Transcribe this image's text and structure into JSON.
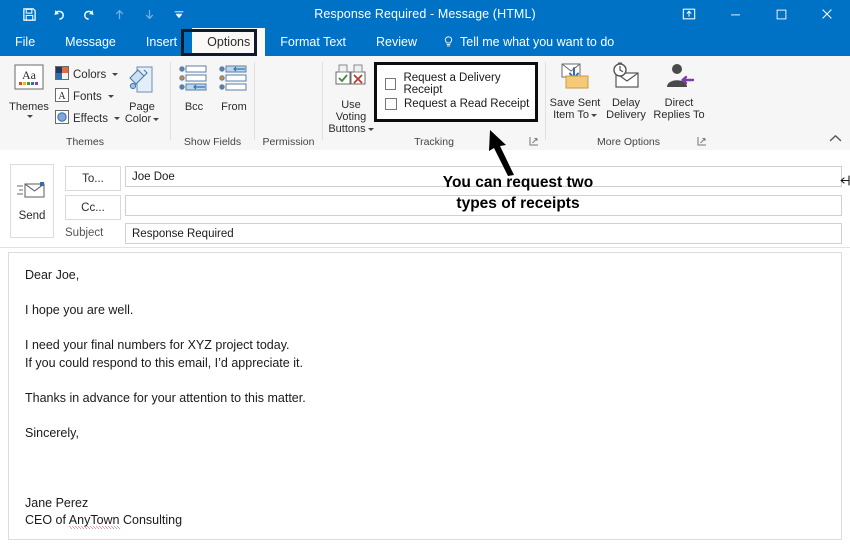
{
  "window": {
    "title": "Response Required  -  Message (HTML)",
    "quick_access": [
      {
        "name": "save-icon",
        "label": "Save",
        "enabled": true
      },
      {
        "name": "undo-icon",
        "label": "Undo",
        "enabled": true
      },
      {
        "name": "redo-icon",
        "label": "Redo",
        "enabled": true
      },
      {
        "name": "previous-item-icon",
        "label": "Previous Item",
        "enabled": false
      },
      {
        "name": "next-item-icon",
        "label": "Next Item",
        "enabled": false
      },
      {
        "name": "customize-quick-access-toolbar-icon",
        "label": "Customize Quick Access Toolbar",
        "enabled": true
      }
    ],
    "controls": [
      {
        "name": "ribbon-display-options",
        "label": "Ribbon Display Options"
      },
      {
        "name": "minimize",
        "label": "Minimize"
      },
      {
        "name": "maximize",
        "label": "Maximize"
      },
      {
        "name": "close",
        "label": "Close"
      }
    ],
    "accent_color": "#0072c6",
    "highlight_color": "#0d1b2a"
  },
  "tabs": [
    {
      "label": "File",
      "active": false
    },
    {
      "label": "Message",
      "active": false
    },
    {
      "label": "Insert",
      "active": false
    },
    {
      "label": "Options",
      "active": true
    },
    {
      "label": "Format Text",
      "active": false
    },
    {
      "label": "Review",
      "active": false
    }
  ],
  "tellme": {
    "label": "Tell me what you want to do",
    "icon": "lightbulb-icon"
  },
  "ribbon": {
    "groups": [
      {
        "label": "Themes",
        "big_buttons": [
          {
            "label": "Themes",
            "icon": "themes-icon",
            "has_caret": true
          }
        ],
        "small_buttons": [
          {
            "label": "Colors",
            "icon": "theme-colors-icon",
            "has_caret": true
          },
          {
            "label": "Fonts",
            "icon": "theme-fonts-icon",
            "has_caret": true
          },
          {
            "label": "Effects",
            "icon": "theme-effects-icon",
            "has_caret": true
          }
        ],
        "page_color": {
          "line1": "Page",
          "line2": "Color",
          "icon": "page-color-icon",
          "has_caret": true
        }
      },
      {
        "label": "Show Fields",
        "big_buttons": [
          {
            "label": "Bcc",
            "icon": "bcc-icon"
          },
          {
            "label": "From",
            "icon": "from-icon"
          }
        ]
      },
      {
        "label": "Permission",
        "big_buttons": []
      },
      {
        "label": "Tracking",
        "voting": {
          "line1": "Use Voting",
          "line2": "Buttons",
          "icon": "use-voting-buttons-icon",
          "has_caret": true
        },
        "checkboxes": [
          {
            "label": "Request a Delivery Receipt",
            "checked": false
          },
          {
            "label": "Request a Read Receipt",
            "checked": false
          }
        ],
        "has_dialog_launcher": true
      },
      {
        "label": "More Options",
        "big_buttons": [
          {
            "line1": "Save Sent",
            "line2": "Item To",
            "icon": "save-sent-item-to-icon",
            "has_caret": true
          },
          {
            "line1": "Delay",
            "line2": "Delivery",
            "icon": "delay-delivery-icon",
            "has_caret": false
          },
          {
            "line1": "Direct",
            "line2": "Replies To",
            "icon": "direct-replies-to-icon",
            "has_caret": false
          }
        ],
        "has_dialog_launcher": true
      }
    ],
    "collapse_label": "Collapse the Ribbon"
  },
  "annotation": {
    "line1": "You can request two",
    "line2": "types of receipts"
  },
  "compose": {
    "send_button": {
      "label": "Send",
      "icon": "send-icon"
    },
    "to": {
      "button_label": "To...",
      "value": "Joe Doe",
      "placeholder": ""
    },
    "cc": {
      "button_label": "Cc...",
      "value": "",
      "placeholder": ""
    },
    "subject": {
      "label": "Subject",
      "value": "Response Required",
      "placeholder": ""
    }
  },
  "body": {
    "lines": [
      {
        "text": "Dear Joe,",
        "blank": false
      },
      {
        "text": "",
        "blank": true
      },
      {
        "text": "I hope you are well.",
        "blank": false
      },
      {
        "text": "",
        "blank": true
      },
      {
        "text": "I need your final numbers for XYZ project today.",
        "blank": false
      },
      {
        "text": "If you could respond to this email, I’d appreciate it.",
        "blank": false
      },
      {
        "text": "",
        "blank": true
      },
      {
        "text": "Thanks in advance for your attention to this matter.",
        "blank": false
      },
      {
        "text": "",
        "blank": true
      },
      {
        "text": "Sincerely,",
        "blank": false
      },
      {
        "text": "",
        "blank": true
      },
      {
        "text": "",
        "blank": true
      },
      {
        "text": "",
        "blank": true
      },
      {
        "text": "Jane Perez",
        "blank": false
      }
    ],
    "signature_role_prefix": "CEO of ",
    "signature_company": "AnyTown",
    "signature_role_suffix": " Consulting",
    "misspelled_word": "AnyTown"
  }
}
